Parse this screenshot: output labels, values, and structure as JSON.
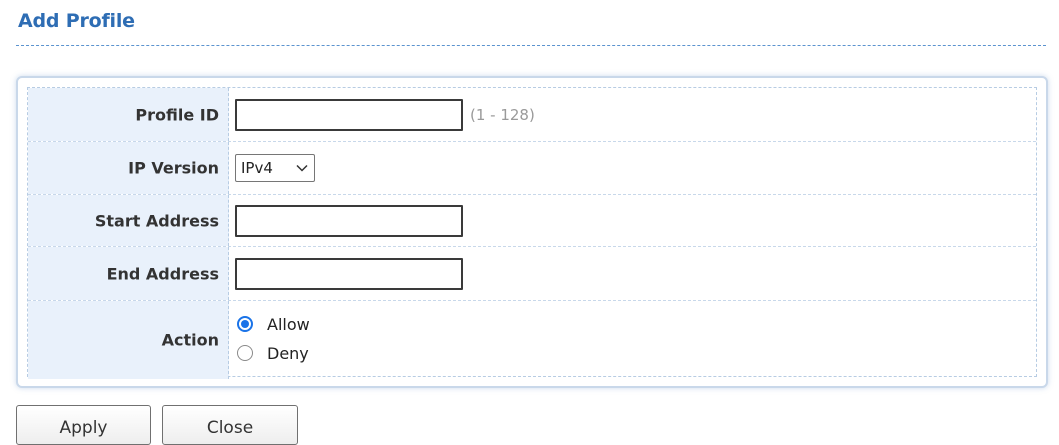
{
  "page": {
    "title": "Add Profile"
  },
  "form": {
    "profile_id": {
      "label": "Profile ID",
      "value": "",
      "hint": "(1 - 128)"
    },
    "ip_version": {
      "label": "IP Version",
      "selected": "IPv4"
    },
    "start_address": {
      "label": "Start Address",
      "value": ""
    },
    "end_address": {
      "label": "End Address",
      "value": ""
    },
    "action": {
      "label": "Action",
      "options": [
        {
          "label": "Allow",
          "checked": true
        },
        {
          "label": "Deny",
          "checked": false
        }
      ]
    }
  },
  "buttons": {
    "apply": "Apply",
    "close": "Close"
  },
  "colors": {
    "title": "#2e6db4",
    "label_bg": "#e9f1fb",
    "radio_accent": "#1a73e8"
  },
  "icons": {
    "select_arrow": "chevron-down-icon"
  }
}
